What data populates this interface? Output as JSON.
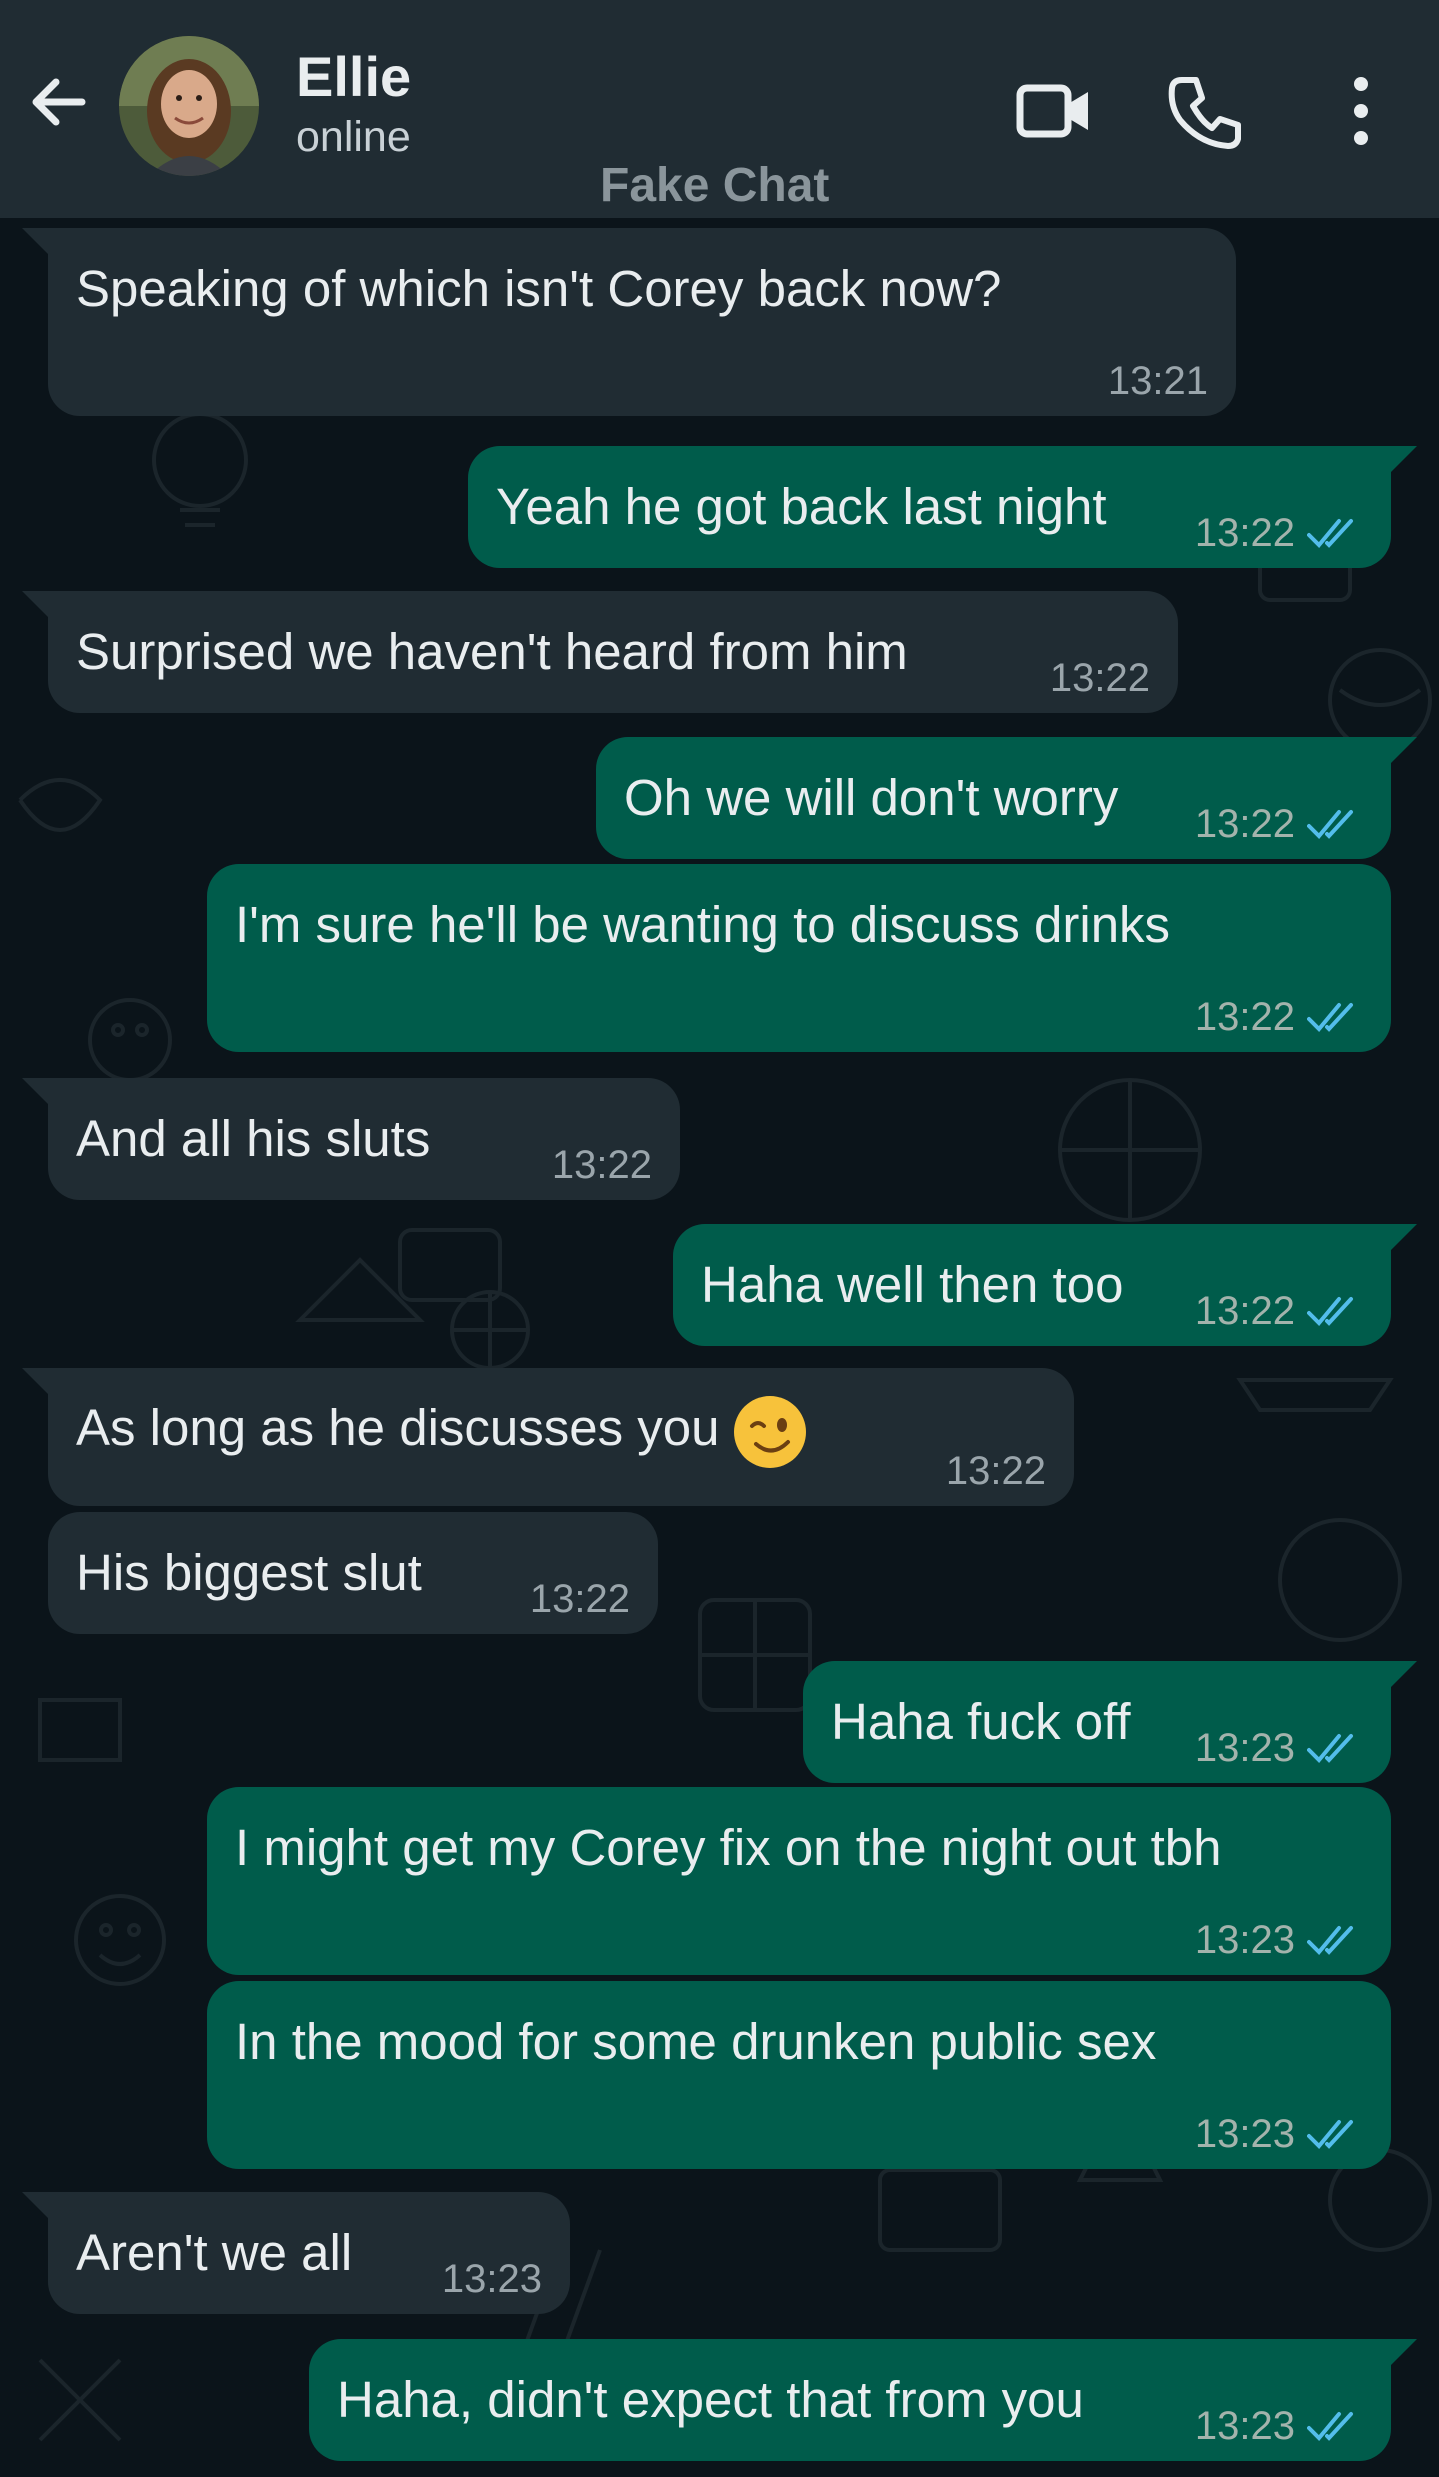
{
  "header": {
    "contact_name": "Ellie",
    "status": "online",
    "watermark": "Fake Chat",
    "icons": [
      "back-arrow-icon",
      "video-call-icon",
      "phone-icon",
      "more-vert-icon"
    ]
  },
  "colors": {
    "header_bg": "#202c33",
    "chat_bg": "#0b141a",
    "incoming_bubble": "#202c33",
    "outgoing_bubble": "#005c4b",
    "read_ticks": "#53bdeb"
  },
  "messages": [
    {
      "dir": "in",
      "text": "Speaking of which isn't Corey back now?",
      "time": "13:21"
    },
    {
      "dir": "out",
      "text": "Yeah he got back last night",
      "time": "13:22"
    },
    {
      "dir": "in",
      "text": "Surprised we haven't heard from him",
      "time": "13:22"
    },
    {
      "dir": "out",
      "text": "Oh we will don't worry",
      "time": "13:22"
    },
    {
      "dir": "out",
      "text": "I'm sure he'll be wanting to discuss drinks",
      "time": "13:22"
    },
    {
      "dir": "in",
      "text": "And all his sluts",
      "time": "13:22"
    },
    {
      "dir": "out",
      "text": "Haha well then too",
      "time": "13:22"
    },
    {
      "dir": "in",
      "text": "As long as he discusses you",
      "emoji": "winking-face",
      "time": "13:22"
    },
    {
      "dir": "in",
      "text": "His biggest slut",
      "time": "13:22"
    },
    {
      "dir": "out",
      "text": "Haha fuck off",
      "time": "13:23"
    },
    {
      "dir": "out",
      "text": "I might get my Corey fix on the night out tbh",
      "time": "13:23"
    },
    {
      "dir": "out",
      "text": "In the mood for some drunken public sex",
      "time": "13:23"
    },
    {
      "dir": "in",
      "text": "Aren't we all",
      "time": "13:23"
    },
    {
      "dir": "out",
      "text": "Haha, didn't expect that from you",
      "time": "13:23"
    }
  ]
}
